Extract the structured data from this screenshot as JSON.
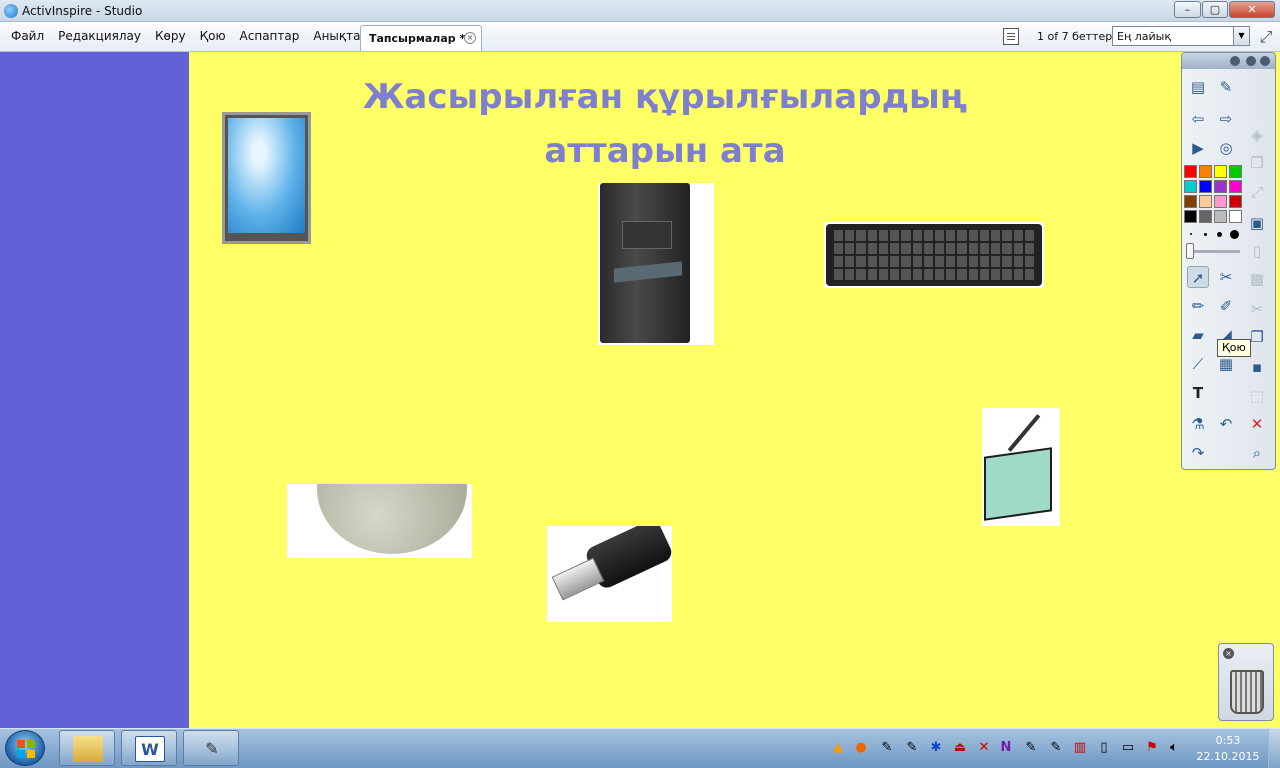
{
  "window": {
    "title": "ActivInspire - Studio",
    "min": "–",
    "max": "▢",
    "close": "✕"
  },
  "menu": {
    "items": [
      "Файл",
      "Редакциялау",
      "Көру",
      "Қою",
      "Аспаптар",
      "Анықтама"
    ]
  },
  "tab": {
    "label": "Тапсырмалар *",
    "close": "×"
  },
  "pages": {
    "count_text": "1 of 7 беттер"
  },
  "zoom": {
    "value": "Ең лайық",
    "arrow": "▼"
  },
  "slide": {
    "title_line1": "Жасырылған құрылғылардың",
    "title_line2": "аттарын ата",
    "background": "#ffff66",
    "title_color": "#7f7fd0",
    "left_panel_color": "#6262d8"
  },
  "toolbox": {
    "tooltip": "Қою",
    "palette": [
      "#ff0000",
      "#ff8000",
      "#ffff00",
      "#00cc00",
      "#00cccc",
      "#0000ff",
      "#9933cc",
      "#ff00cc",
      "#804000",
      "#ffcc99",
      "#ff99cc",
      "#cc0000",
      "#000000",
      "#666666",
      "#bbbbbb",
      "#ffffff"
    ]
  },
  "taskbar": {
    "time": "0:53",
    "date": "22.10.2015",
    "word_glyph": "W"
  }
}
